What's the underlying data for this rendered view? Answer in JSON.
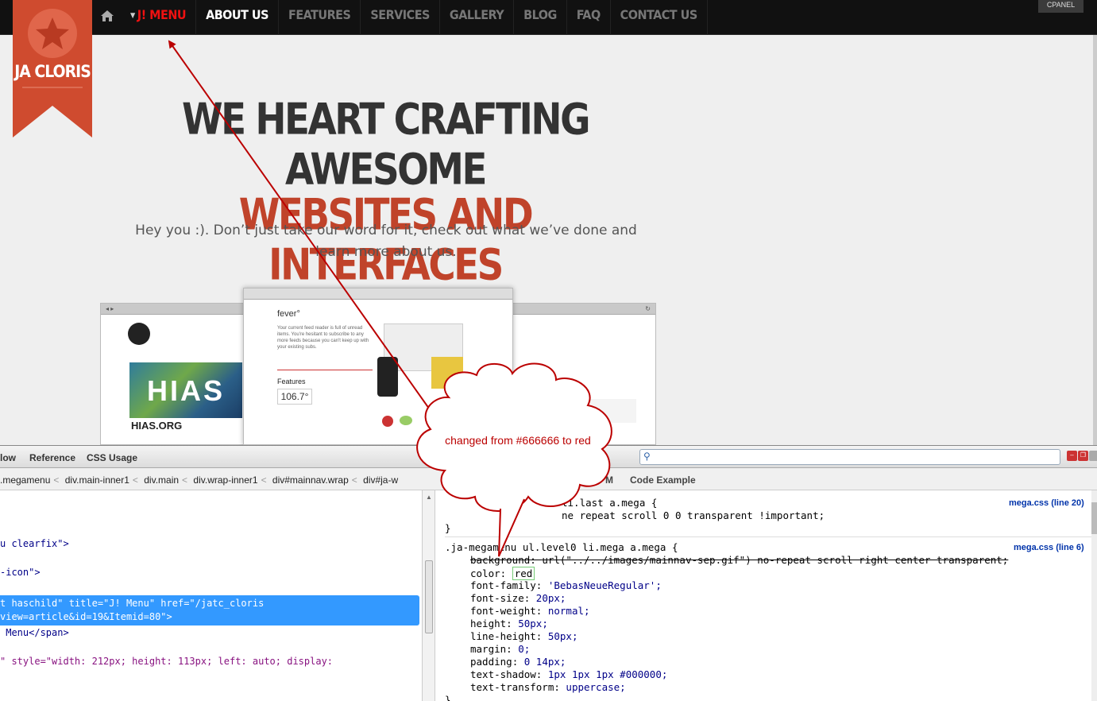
{
  "site": {
    "logo_text": "JA CLORIS",
    "nav": [
      {
        "label": "J! MENU"
      },
      {
        "label": "ABOUT US"
      },
      {
        "label": "FEATURES"
      },
      {
        "label": "SERVICES"
      },
      {
        "label": "GALLERY"
      },
      {
        "label": "BLOG"
      },
      {
        "label": "FAQ"
      },
      {
        "label": "CONTACT US"
      }
    ],
    "cpanel_label": "CPANEL",
    "hero_line1": "WE HEART CRAFTING AWESOME",
    "hero_line2": "WEBSITES AND INTERFACES",
    "hero_sub": "Hey you :). Don’t just take our word for it, check out what we’ve done and learn more about us.",
    "preview": {
      "left_site": "HIAS.ORG",
      "left_banner": "HIAS",
      "center_logo": "fever°",
      "center_text": "Your current feed reader is full of unread items. You're hesitant to subscribe to any more feeds because you can't keep up with your existing subs.",
      "center_features": "Features",
      "center_temp": "106.7°"
    },
    "colors": {
      "accent_red": "#c0432a",
      "nav_active": "#ffffff",
      "changed_red": "#ff0000"
    }
  },
  "devtools": {
    "tabs": [
      {
        "label": "low"
      },
      {
        "label": "Reference"
      },
      {
        "label": "CSS Usage"
      }
    ],
    "breadcrumbs": [
      ".megamenu",
      "div.main-inner1",
      "div.main",
      "div.wrap-inner1",
      "div#mainnav.wrap",
      "div#ja-w"
    ],
    "side_tabs": [
      {
        "label": "M"
      },
      {
        "label": "Code Example"
      }
    ],
    "html_lines": [
      {
        "text": "u clearfix\">"
      },
      {
        "text": "-icon\">"
      },
      {
        "text": "t haschild\" title=\"J! Menu\" href=\"/jatc_cloris"
      },
      {
        "text": "view=article&id=19&Itemid=80\">"
      },
      {
        "text": " Menu</span>"
      },
      {
        "text": "\" style=\"width: 212px; height: 113px; left: auto; display:"
      }
    ],
    "css_rules": [
      {
        "selector": "li.last a.mega {",
        "file": "mega.css (line 20)",
        "props": [
          {
            "text": "ne repeat scroll 0 0 transparent !important;"
          }
        ]
      },
      {
        "selector": ".ja-megamenu ul.level0 li.mega a.mega {",
        "file": "mega.css (line 6)",
        "props": [
          {
            "name": "background",
            "value": "url(\"../../images/mainnav-sep.gif\") no-repeat scroll right center transparent;"
          },
          {
            "name": "color",
            "value": "red"
          },
          {
            "name": "font-family",
            "value": "'BebasNeueRegular';"
          },
          {
            "name": "font-size",
            "value": "20px;"
          },
          {
            "name": "font-weight",
            "value": "normal;"
          },
          {
            "name": "height",
            "value": "50px;"
          },
          {
            "name": "line-height",
            "value": "50px;"
          },
          {
            "name": "margin",
            "value": "0;"
          },
          {
            "name": "padding",
            "value": "0 14px;"
          },
          {
            "name": "text-shadow",
            "value": "1px 1px 1px #000000;"
          },
          {
            "name": "text-transform",
            "value": "uppercase;"
          }
        ]
      }
    ],
    "closing_brace": "}"
  },
  "annotation": {
    "text": "changed from #666666 to red"
  }
}
